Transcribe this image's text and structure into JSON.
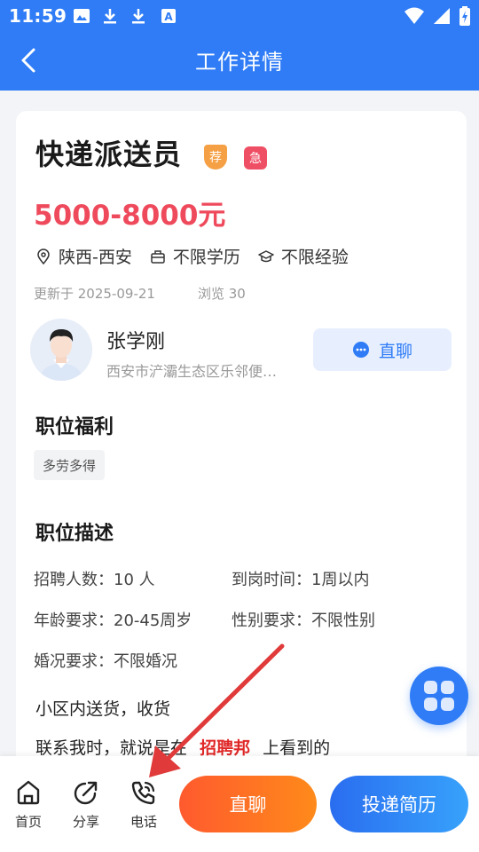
{
  "status_bar": {
    "time": "11:59"
  },
  "header": {
    "title": "工作详情"
  },
  "job": {
    "title": "快递派送员",
    "tag_recommend": "荐",
    "tag_urgent": "急",
    "salary": "5000-8000元",
    "location": "陕西-西安",
    "education": "不限学历",
    "experience": "不限经验",
    "updated": "更新于 2025-09-21",
    "views": "浏览 30"
  },
  "recruiter": {
    "name": "张学刚",
    "address": "西安市浐灞生态区乐邻便…",
    "chat_label": "直聊"
  },
  "benefits": {
    "title": "职位福利",
    "items": [
      "多劳多得"
    ]
  },
  "description": {
    "title": "职位描述",
    "headcount": "招聘人数：10 人",
    "arrival": "到岗时间：1周以内",
    "age": "年龄要求：20-45周岁",
    "gender": "性别要求：不限性别",
    "marital": "婚况要求：不限婚况",
    "text": "小区内送货，收货",
    "contact_prefix": "联系我时，就说是在",
    "contact_brand": "招聘邦",
    "contact_suffix": "上看到的"
  },
  "bottom_bar": {
    "home": "首页",
    "share": "分享",
    "phone": "电话",
    "chat_button": "直聊",
    "apply_button": "投递简历"
  },
  "colors": {
    "primary": "#2f7cf6",
    "salary": "#ee4a5c",
    "brand_text": "#e02828",
    "annotation_arrow": "#e03a3a"
  }
}
